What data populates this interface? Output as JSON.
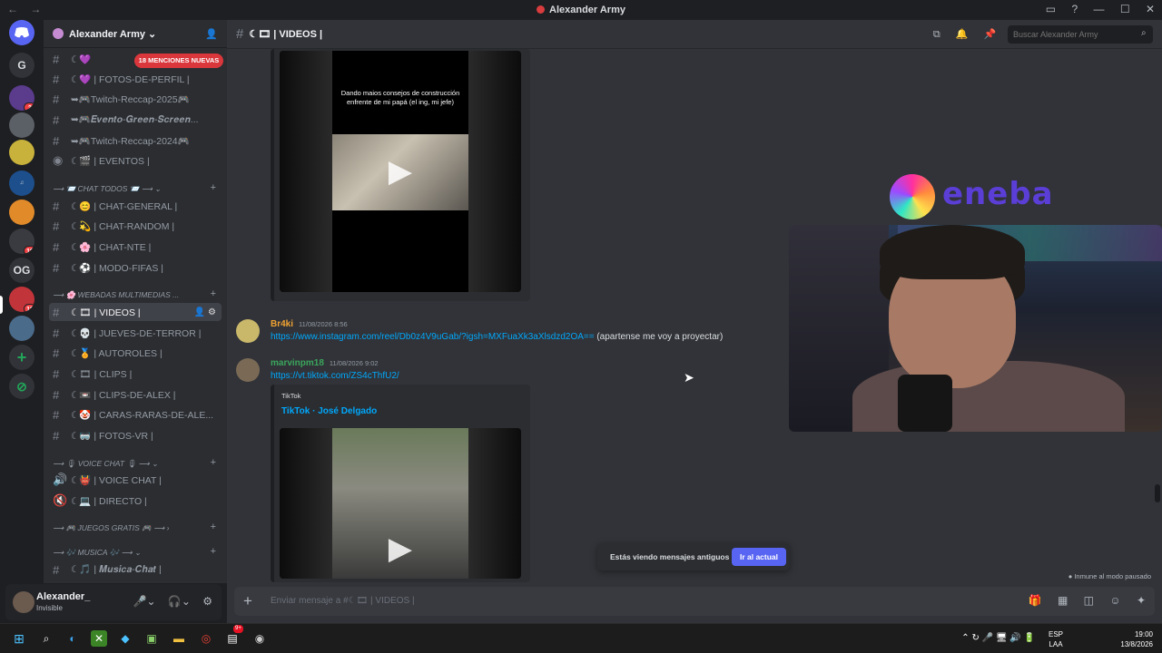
{
  "window": {
    "title": "Alexander Army",
    "nav_back": "←",
    "nav_fwd": "→",
    "controls": [
      "▭",
      "?",
      "—",
      "☐",
      "✕"
    ]
  },
  "guilds": {
    "items": [
      "G",
      "OG"
    ],
    "badges": [
      "2",
      "19",
      "18"
    ]
  },
  "server": {
    "name": "Alexander Army ⌄"
  },
  "mentions_pill": "18 MENCIONES NUEVAS",
  "channels": [
    {
      "label": "☾💜 | FOTOS-DE-PERFIL |"
    },
    {
      "label": "➥🎮Twitch-Reccap-2025🎮"
    },
    {
      "label": "➥🎮𝑬𝒗𝒆𝒏𝒕𝒐-𝑮𝒓𝒆𝒆𝒏-𝑺𝒄𝒓𝒆𝒆𝒏..."
    },
    {
      "label": "➥🎮Twitch-Reccap-2024🎮"
    },
    {
      "label": "☾🎬 | EVENTOS |"
    }
  ],
  "categories": {
    "chat_todos": "⟶ 📨 CHAT TODOS 📨 ⟶ ⌄",
    "webadas": "⟶ 🌸 WEBADAS MULTIMEDIAS ...",
    "voice_chat": "⟶ 🎙 VOICE CHAT 🎙 ⟶ ⌄",
    "juegos": "⟶ 🎮 JUEGOS GRATIS 🎮 ⟶ ›",
    "musica": "⟶ 🎶 MUSICA 🎶 ⟶ ⌄"
  },
  "chat_channels": [
    "☾😊 | CHAT-GENERAL |",
    "☾💫 | CHAT-RANDOM |",
    "☾🌸 | CHAT-NTE |",
    "☾⚽ | MODO-FIFAS |"
  ],
  "media_channels": [
    "☾🎞 | VIDEOS |",
    "☾💀 | JUEVES-DE-TERROR |",
    "☾🏅 | AUTOROLES |",
    "☾🎞 | CLIPS |",
    "☾📼 | CLIPS-DE-ALEX |",
    "☾🤡 | CARAS-RARAS-DE-ALE...",
    "☾🥽 | FOTOS-VR |"
  ],
  "voice_channels": [
    "☾👹 | VOICE CHAT |",
    "☾💻 | DIRECTO |"
  ],
  "music_channels": [
    "☾🎵 | 𝑴𝒖𝒔𝒊𝒄𝒂-𝑪𝒉𝒂𝒕 |"
  ],
  "user": {
    "name": "Alexander_",
    "status": "Invisible"
  },
  "channel_header": {
    "name": "☾🎞 | VIDEOS |",
    "search_placeholder": "Buscar Alexander Army"
  },
  "messages": [
    {
      "author": "Br4ki",
      "time": "11/08/2026 8:56",
      "color": "#f0a232",
      "link": "https://www.instagram.com/reel/Db0z4V9uGab/?igsh=MXFuaXk3aXlsdzd2OA==",
      "text": " (apartense me voy a proyectar)"
    },
    {
      "author": "marvinpm18",
      "time": "11/08/2026 9:02",
      "color": "#3ba55c",
      "link": "https://vt.tiktok.com/ZS4cThfU2/",
      "embed_provider": "TikTok",
      "embed_title": "TikTok · José Delgado"
    }
  ],
  "video_caption": "Dando maios consejos de construcción enfrente de mi papá (el ing, mi jefe)",
  "old_banner": {
    "text": "Estás viendo mensajes antiguos",
    "button": "Ir al actual"
  },
  "immune": "● Inmune al modo pausado",
  "composer": {
    "placeholder": "Enviar mensaje a #☾🎞 | VIDEOS |"
  },
  "overlay": {
    "brand": "eneba"
  },
  "taskbar": {
    "lang1": "ESP",
    "lang2": "LAA",
    "time": "19:00",
    "date": "13/8/2026",
    "badge": "9+"
  }
}
